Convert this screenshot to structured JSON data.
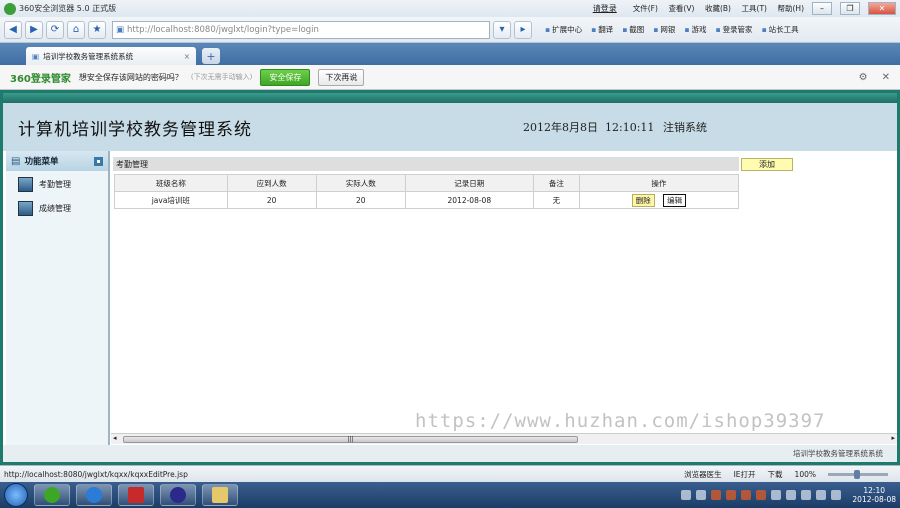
{
  "browser": {
    "title": "360安全浏览器 5.0 正式版",
    "login_link": "请登录",
    "menu": [
      "文件(F)",
      "查看(V)",
      "收藏(B)",
      "工具(T)",
      "帮助(H)"
    ],
    "address": "http://localhost:8080/jwglxt/login?type=login",
    "address_host": "localhost",
    "toolbar": [
      "扩展中心",
      "翻译",
      "截图",
      "网银",
      "游戏",
      "登录管家",
      "站长工具"
    ],
    "tab_title": "培训学校教务管理系统系统",
    "status_url": "http://localhost:8080/jwglxt/kqxx/kqxxEditPre.jsp",
    "status_items": [
      "浏览器医生",
      "IE打开",
      "下载"
    ],
    "zoom": "100%"
  },
  "password_bar": {
    "brand": "360登录管家",
    "question": "想安全保存该网站的密码吗？",
    "hint": "(下次无需手动输入)",
    "save_label": "安全保存",
    "later_label": "下次再说"
  },
  "page": {
    "system_title": "计算机培训学校教务管理系统",
    "date": "2012年8月8日",
    "time": "12:10:11",
    "logout": "注销系统",
    "footer": "培训学校教务管理系统系统"
  },
  "sidebar": {
    "header": "功能菜单",
    "items": [
      {
        "label": "考勤管理"
      },
      {
        "label": "成绩管理"
      }
    ]
  },
  "main": {
    "section_title": "考勤管理",
    "add_label": "添加",
    "columns": [
      "班级名称",
      "应到人数",
      "实际人数",
      "记录日期",
      "备注",
      "操作"
    ],
    "rows": [
      {
        "class_name": "java培训班",
        "expected": "20",
        "actual": "20",
        "date": "2012-08-08",
        "note": "无",
        "delete": "删除",
        "edit": "编辑"
      }
    ]
  },
  "watermark": "https://www.huzhan.com/ishop39397",
  "taskbar": {
    "clock_time": "12:10",
    "clock_date": "2012-08-08"
  }
}
